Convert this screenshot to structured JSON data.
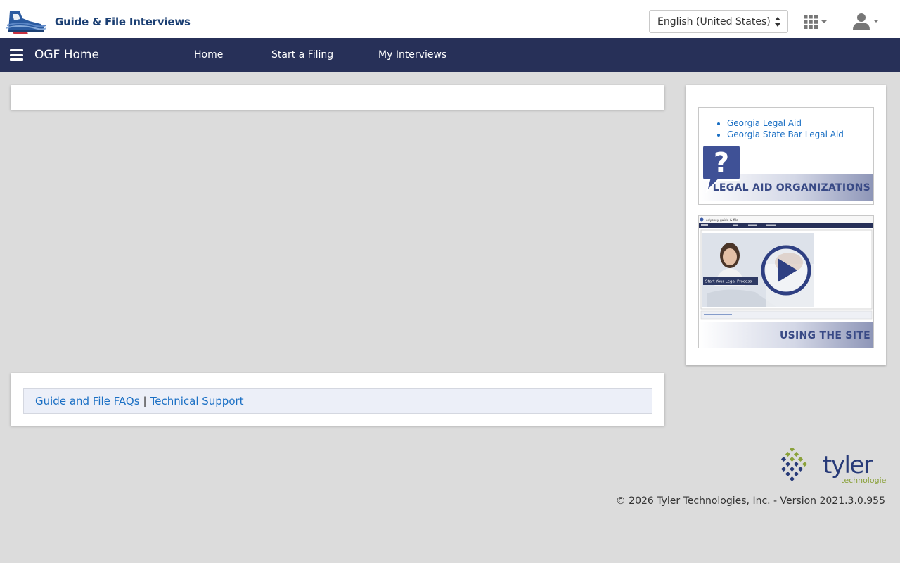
{
  "header": {
    "logo_text": "Guide & File Interviews",
    "language_selected": "English (United States)"
  },
  "nav": {
    "title": "OGF Home",
    "links": [
      "Home",
      "Start a Filing",
      "My Interviews"
    ]
  },
  "main": {
    "footer_links": {
      "faq": "Guide and File FAQs",
      "separator": "|",
      "support": "Technical Support"
    }
  },
  "sidebar": {
    "legal_aid": {
      "links": [
        "Georgia Legal Aid",
        "Georgia State Bar Legal Aid"
      ],
      "banner": "LEGAL AID ORGANIZATIONS"
    },
    "video": {
      "banner": "USING THE SITE",
      "thumbnail_caption": "Start Your Legal Process",
      "thumbnail_app_title": "odyssey guide & file"
    }
  },
  "footer": {
    "brand": "tyler",
    "brand_sub": "technologies",
    "copyright": "© 2026 Tyler Technologies, Inc. - Version 2021.3.0.955"
  },
  "colors": {
    "navbar": "#273058",
    "link": "#1a6fc4",
    "banner_text": "#394a86",
    "background": "#dcdcdc"
  },
  "icons": [
    "shoe-logo-icon",
    "select-arrows-icon",
    "apps-grid-icon",
    "user-icon",
    "hamburger-icon",
    "question-bubble-icon",
    "play-icon",
    "tyler-logo-icon"
  ]
}
